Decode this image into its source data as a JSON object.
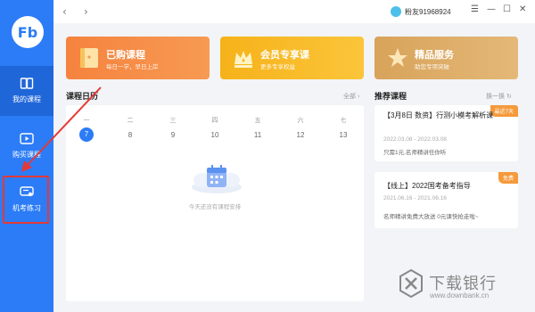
{
  "app": {
    "logo_text": "Fb"
  },
  "sidebar": {
    "items": [
      {
        "label": "我的课程",
        "active": true
      },
      {
        "label": "购买课程",
        "active": false
      },
      {
        "label": "机考练习",
        "active": false
      }
    ]
  },
  "topbar": {
    "back": "‹",
    "forward": "›",
    "username": "粉友91968924",
    "window_controls": {
      "menu": "☰",
      "minimize": "—",
      "maximize": "☐",
      "close": "✕"
    }
  },
  "banners": [
    {
      "title": "已购课程",
      "subtitle": "每日一学，早日上岸",
      "icon": "book-icon"
    },
    {
      "title": "会员专享课",
      "subtitle": "更多专享权益",
      "icon": "crown-icon"
    },
    {
      "title": "精品服务",
      "subtitle": "助您专项突破",
      "icon": "star-icon"
    }
  ],
  "calendar": {
    "title": "课程日历",
    "see_all": "全部 ›",
    "weekdays": [
      "一",
      "二",
      "三",
      "四",
      "五",
      "六",
      "七"
    ],
    "dates": [
      "7",
      "8",
      "9",
      "10",
      "11",
      "12",
      "13"
    ],
    "today_index": 0,
    "empty_text": "今天还没有课程安排"
  },
  "recommend": {
    "title": "推荐课程",
    "refresh": "换一换 ↻",
    "items": [
      {
        "tag": "最近7天",
        "title": "【3月8日 数资】行测小模考解析课",
        "date": "2022.03.08 - 2022.03.08",
        "desc": "只需1元,名师精讲任你听"
      },
      {
        "tag": "免费",
        "title": "【线上】2022国考备考指导",
        "date": "2021.06.16 - 2021.06.16",
        "desc": "名师精讲免费大放送 0元课快抢走啦~"
      }
    ]
  },
  "watermark": {
    "text": "下载银行",
    "url": "www.downbank.cn"
  },
  "colors": {
    "primary": "#2b7cf6",
    "annotation": "#e53935"
  }
}
